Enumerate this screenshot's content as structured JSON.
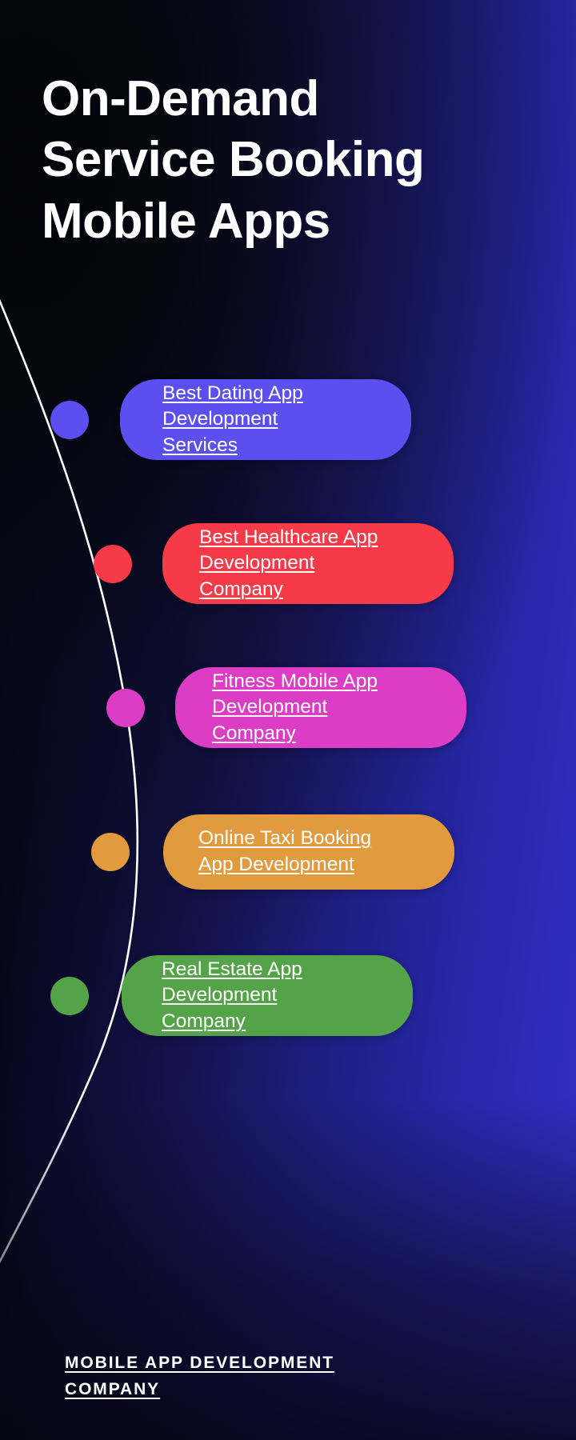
{
  "document": {
    "title_lines": [
      "On-Demand",
      "Service Booking",
      "Mobile Apps"
    ],
    "background": {
      "from": "#000003",
      "to": "#3330c8"
    },
    "accent_line_color": "#ffffff"
  },
  "items": [
    {
      "id": "dating",
      "label": "Best Dating App Development Services",
      "lines": [
        "Best Dating App",
        "Development",
        "Services"
      ],
      "color": "#5B4FF0",
      "dot_color": "#5B4FF0"
    },
    {
      "id": "healthcare",
      "label": "Best Healthcare App Development Company",
      "lines": [
        "Best Healthcare App",
        "Development",
        "Company"
      ],
      "color": "#F73A48",
      "dot_color": "#F73A48"
    },
    {
      "id": "fitness",
      "label": "Fitness Mobile App Development Company",
      "lines": [
        "Fitness Mobile App",
        "Development",
        "Company"
      ],
      "color": "#DC3DC4",
      "dot_color": "#DC3DC4"
    },
    {
      "id": "taxi",
      "label": "Online Taxi Booking App Development",
      "lines": [
        "Online Taxi Booking",
        "App Development"
      ],
      "color": "#E29A3E",
      "dot_color": "#E29A3E"
    },
    {
      "id": "realestate",
      "label": "Real Estate App Development Company",
      "lines": [
        "Real Estate App",
        "Development",
        "Company"
      ],
      "color": "#55A348",
      "dot_color": "#55A348"
    }
  ],
  "footer": {
    "lines": [
      "MOBILE APP DEVELOPMENT",
      "COMPANY"
    ],
    "text": "MOBILE APP DEVELOPMENT COMPANY"
  }
}
